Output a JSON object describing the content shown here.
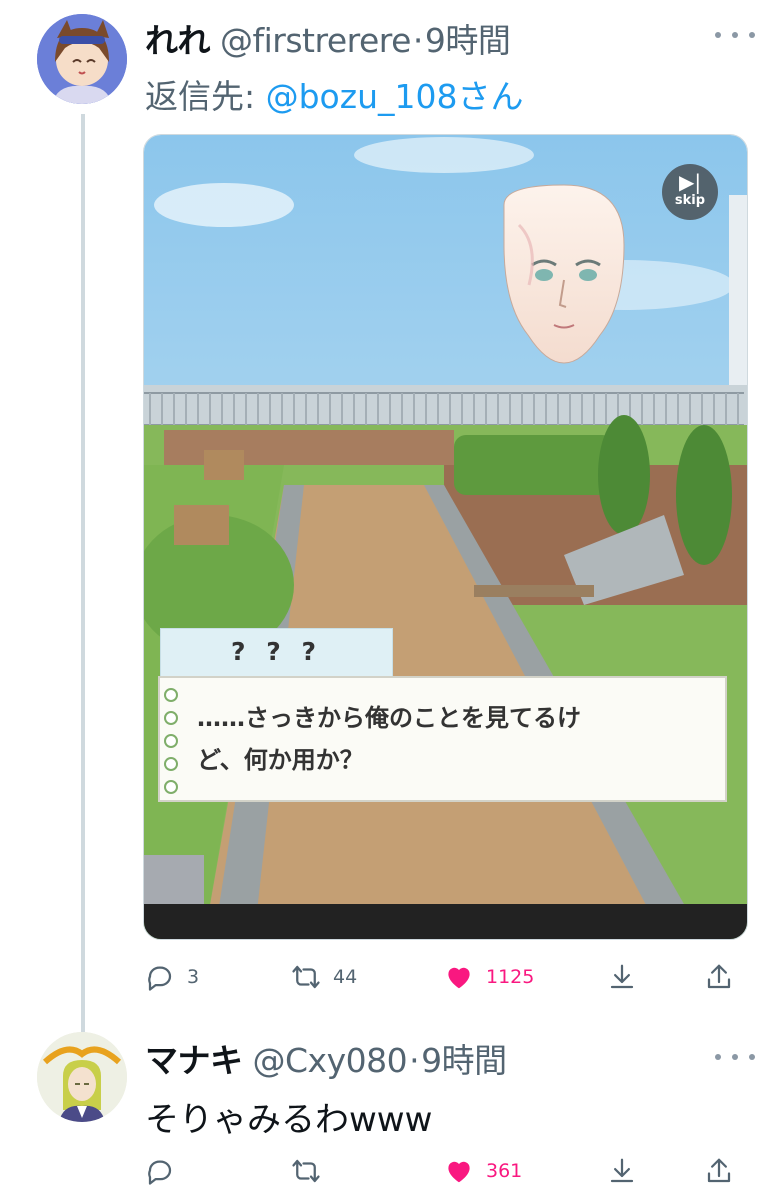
{
  "tweet1": {
    "display_name": "れれ",
    "handle": "@firstrerere",
    "separator": "·",
    "time": "9時間",
    "reply_prefix": "返信先: ",
    "reply_mention": "@bozu_108さん",
    "media": {
      "skip_label": "skip",
      "speaker": "? ? ?",
      "dialog_line1": "……さっきから俺のことを見てるけ",
      "dialog_line2": "ど、何か用か？"
    },
    "actions": {
      "replies": "3",
      "retweets": "44",
      "likes": "1125"
    }
  },
  "tweet2": {
    "display_name": "マナキ",
    "handle": "@Cxy080",
    "separator": "·",
    "time": "9時間",
    "text": "そりゃみるわwww",
    "actions": {
      "likes": "361"
    }
  },
  "colors": {
    "like": "#f91880",
    "link": "#1d9bf0",
    "muted": "#536471",
    "thread_line": "#cfd9de"
  },
  "icons": [
    "more-icon",
    "reply-icon",
    "retweet-icon",
    "like-icon",
    "bookmark-icon",
    "share-icon",
    "skip-icon"
  ]
}
